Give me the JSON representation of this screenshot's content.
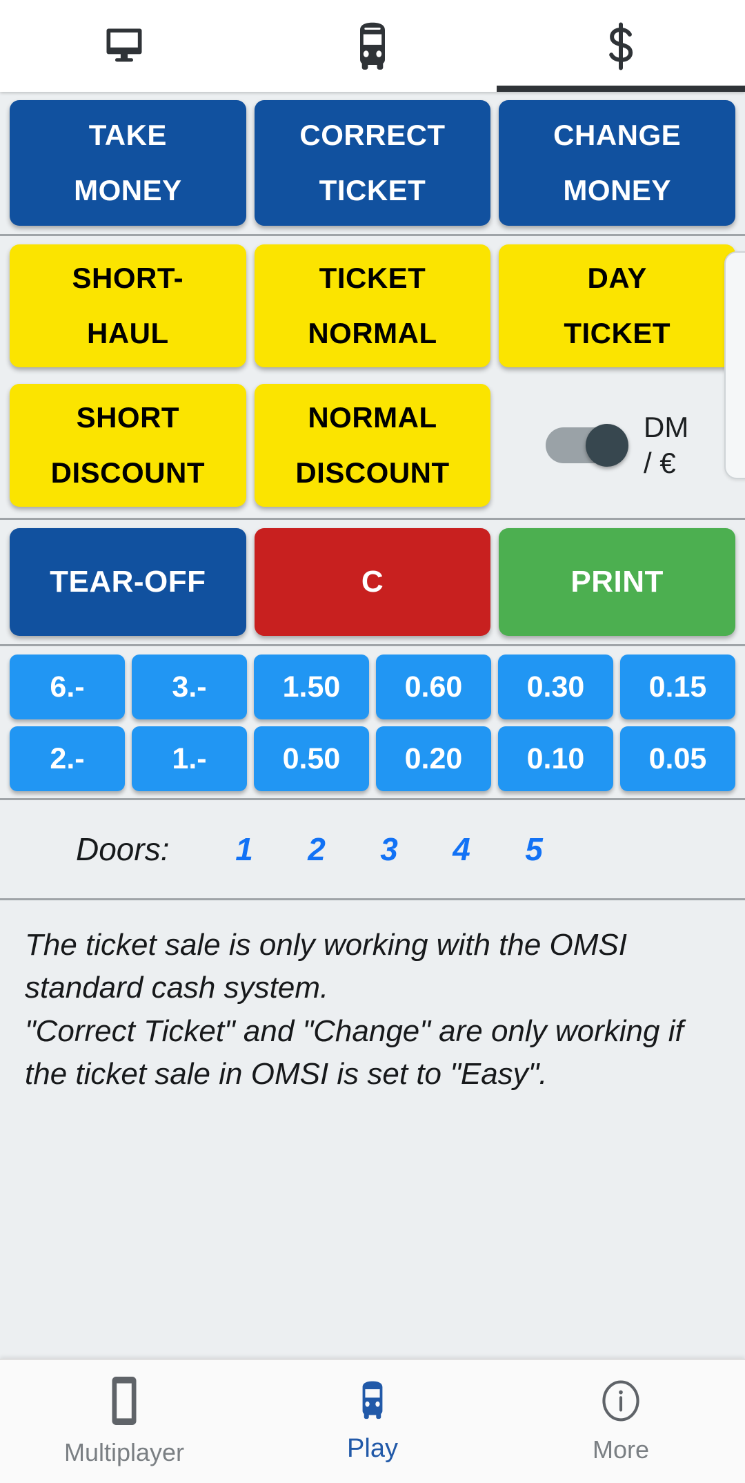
{
  "top_tabs": [
    {
      "id": "monitor",
      "icon": "monitor-icon",
      "active": false
    },
    {
      "id": "bus",
      "icon": "bus-icon",
      "active": false
    },
    {
      "id": "money",
      "icon": "dollar-icon",
      "active": true
    }
  ],
  "money_actions": {
    "take_money": {
      "line1": "TAKE",
      "line2": "MONEY"
    },
    "correct_ticket": {
      "line1": "CORRECT",
      "line2": "TICKET"
    },
    "change_money": {
      "line1": "CHANGE",
      "line2": "MONEY"
    }
  },
  "tickets": {
    "short_haul": {
      "line1": "SHORT-",
      "line2": "HAUL"
    },
    "ticket_normal": {
      "line1": "TICKET",
      "line2": "NORMAL"
    },
    "day_ticket": {
      "line1": "DAY",
      "line2": "TICKET"
    },
    "short_discount": {
      "line1": "SHORT",
      "line2": "DISCOUNT"
    },
    "normal_discount": {
      "line1": "NORMAL",
      "line2": "DISCOUNT"
    },
    "currency_toggle": {
      "label": "DM\n/ €",
      "state": "on"
    }
  },
  "actions": {
    "tear_off": "TEAR-OFF",
    "clear": "C",
    "print": "PRINT"
  },
  "denominations": {
    "row1": [
      "6.-",
      "3.-",
      "1.50",
      "0.60",
      "0.30",
      "0.15"
    ],
    "row2": [
      "2.-",
      "1.-",
      "0.50",
      "0.20",
      "0.10",
      "0.05"
    ]
  },
  "doors": {
    "label": "Doors:",
    "buttons": [
      "1",
      "2",
      "3",
      "4",
      "5"
    ]
  },
  "note": {
    "text": "The ticket sale is only working with the OMSI standard cash system.\n\"Correct Ticket\" and \"Change\" are only working if the ticket sale in OMSI is set to \"Easy\"."
  },
  "bottom_nav": [
    {
      "id": "multiplayer",
      "label": "Multiplayer",
      "icon": "phone-icon",
      "active": false
    },
    {
      "id": "play",
      "label": "Play",
      "icon": "bus-icon",
      "active": true
    },
    {
      "id": "more",
      "label": "More",
      "icon": "info-icon",
      "active": false
    }
  ],
  "colors": {
    "dark_blue": "#11519f",
    "yellow": "#fbe400",
    "red": "#c8201f",
    "green": "#4caf50",
    "light_blue": "#2196f3",
    "accent": "#2159a8",
    "background": "#eceff1"
  }
}
